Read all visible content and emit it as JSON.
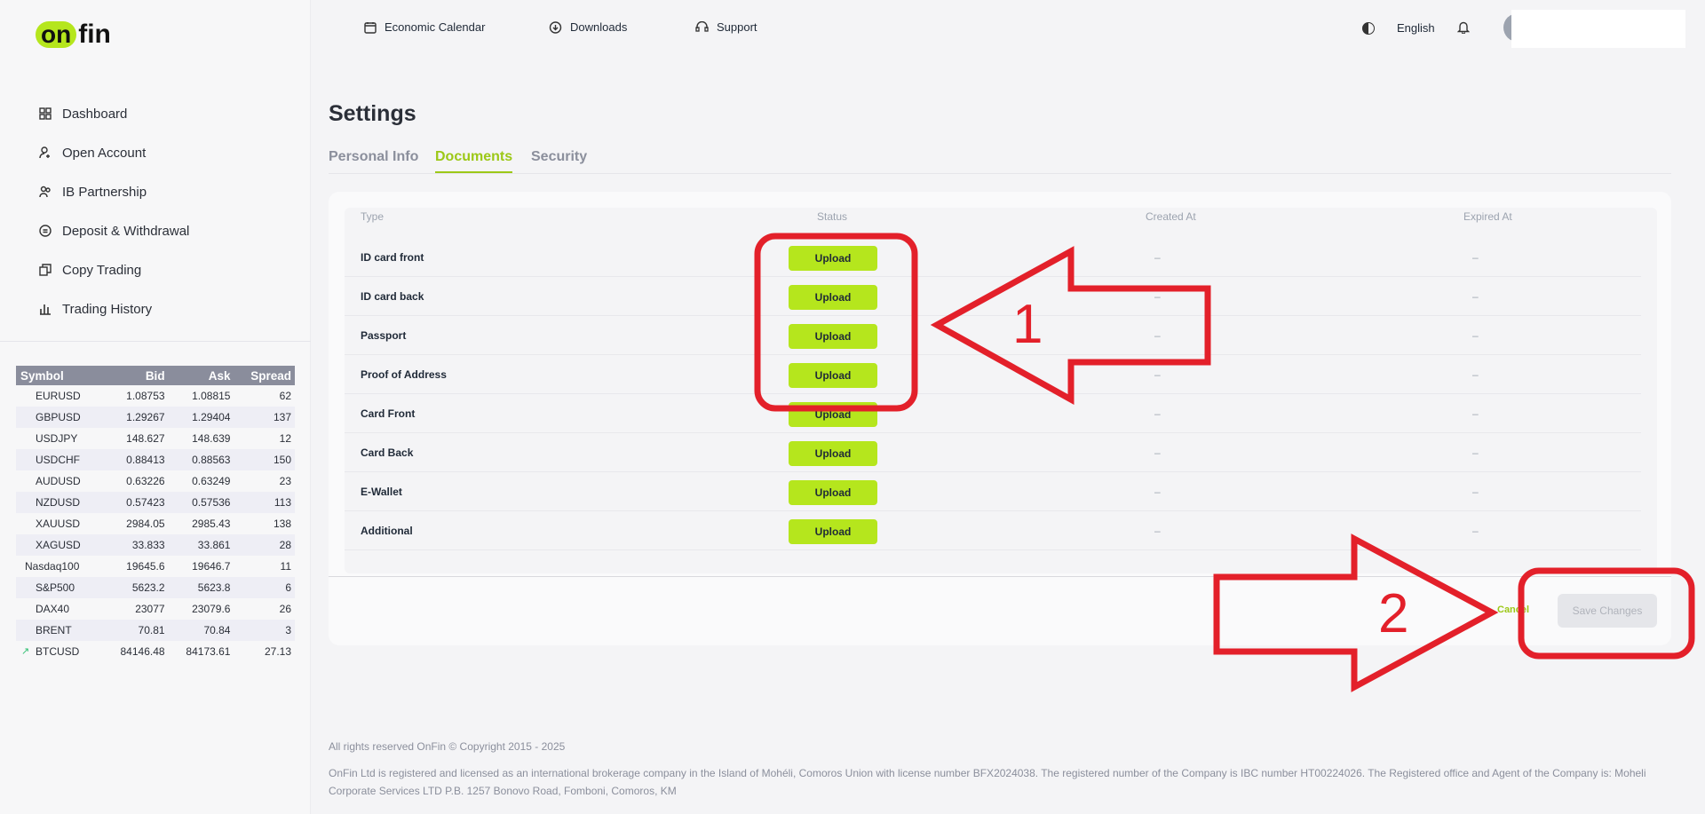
{
  "brand": {
    "logo_part1": "on",
    "logo_part2": "fin"
  },
  "sidebar": {
    "items": [
      {
        "label": "Dashboard",
        "icon": "grid-icon"
      },
      {
        "label": "Open Account",
        "icon": "user-plus-icon"
      },
      {
        "label": "IB Partnership",
        "icon": "users-icon"
      },
      {
        "label": "Deposit & Withdrawal",
        "icon": "coin-icon"
      },
      {
        "label": "Copy Trading",
        "icon": "copy-icon"
      },
      {
        "label": "Trading History",
        "icon": "bar-chart-icon"
      }
    ]
  },
  "quotes": {
    "headers": [
      "Symbol",
      "Bid",
      "Ask",
      "Spread"
    ],
    "rows": [
      {
        "symbol": "EURUSD",
        "bid": "1.08753",
        "ask": "1.08815",
        "spread": "62"
      },
      {
        "symbol": "GBPUSD",
        "bid": "1.29267",
        "ask": "1.29404",
        "spread": "137"
      },
      {
        "symbol": "USDJPY",
        "bid": "148.627",
        "ask": "148.639",
        "spread": "12"
      },
      {
        "symbol": "USDCHF",
        "bid": "0.88413",
        "ask": "0.88563",
        "spread": "150"
      },
      {
        "symbol": "AUDUSD",
        "bid": "0.63226",
        "ask": "0.63249",
        "spread": "23"
      },
      {
        "symbol": "NZDUSD",
        "bid": "0.57423",
        "ask": "0.57536",
        "spread": "113"
      },
      {
        "symbol": "XAUUSD",
        "bid": "2984.05",
        "ask": "2985.43",
        "spread": "138"
      },
      {
        "symbol": "XAGUSD",
        "bid": "33.833",
        "ask": "33.861",
        "spread": "28"
      },
      {
        "symbol": "Nasdaq100",
        "bid": "19645.6",
        "ask": "19646.7",
        "spread": "11"
      },
      {
        "symbol": "S&P500",
        "bid": "5623.2",
        "ask": "5623.8",
        "spread": "6"
      },
      {
        "symbol": "DAX40",
        "bid": "23077",
        "ask": "23079.6",
        "spread": "26"
      },
      {
        "symbol": "BRENT",
        "bid": "70.81",
        "ask": "70.84",
        "spread": "3"
      },
      {
        "symbol": "BTCUSD",
        "bid": "84146.48",
        "ask": "84173.61",
        "spread": "27.13"
      }
    ]
  },
  "topbar": {
    "economic_calendar": "Economic Calendar",
    "downloads": "Downloads",
    "support": "Support",
    "language": "English"
  },
  "main": {
    "title": "Settings",
    "tabs": [
      "Personal Info",
      "Documents",
      "Security"
    ],
    "table": {
      "headers": [
        "Type",
        "Status",
        "Created At",
        "Expired At"
      ],
      "rows": [
        {
          "type": "ID card front",
          "status": "Upload",
          "created": "–",
          "expired": "–"
        },
        {
          "type": "ID card back",
          "status": "Upload",
          "created": "–",
          "expired": "–"
        },
        {
          "type": "Passport",
          "status": "Upload",
          "created": "–",
          "expired": "–"
        },
        {
          "type": "Proof of Address",
          "status": "Upload",
          "created": "–",
          "expired": "–"
        },
        {
          "type": "Card Front",
          "status": "Upload",
          "created": "–",
          "expired": "–"
        },
        {
          "type": "Card Back",
          "status": "Upload",
          "created": "–",
          "expired": "–"
        },
        {
          "type": "E-Wallet",
          "status": "Upload",
          "created": "–",
          "expired": "–"
        },
        {
          "type": "Additional",
          "status": "Upload",
          "created": "–",
          "expired": "–"
        }
      ]
    },
    "cancel": "Cancel",
    "save": "Save Changes"
  },
  "footer": {
    "copyright": "All rights reserved OnFin © Copyright 2015 - 2025",
    "legal": "OnFin Ltd is registered and licensed as an international brokerage company in the Island of Mohéli, Comoros Union with license number BFX2024038. The registered number of the Company is IBC number HT00224026. The Registered office and Agent of the Company is: Moheli Corporate Services LTD P.B. 1257 Bonovo Road, Fomboni, Comoros, KM"
  },
  "annotations": {
    "label1": "1",
    "label2": "2",
    "color": "#e3202a"
  },
  "colors": {
    "accent": "#b5e61d",
    "accent_text": "#9cc817"
  }
}
